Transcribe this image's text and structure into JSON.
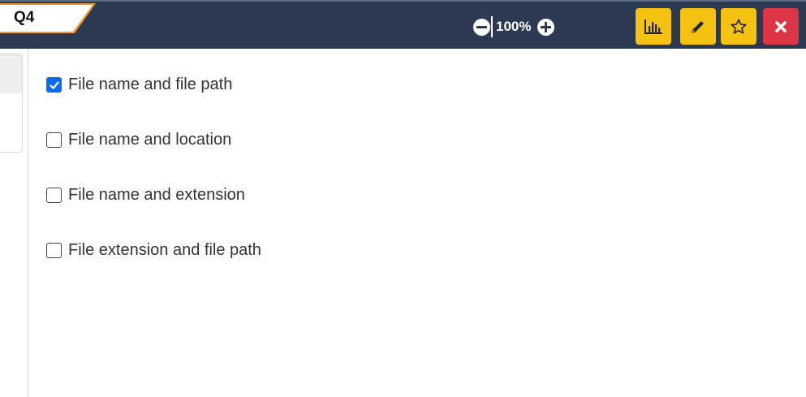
{
  "header": {
    "question_tab": "Q4",
    "zoom_level": "100%",
    "tools": [
      {
        "name": "stats",
        "icon": "bar-chart-icon"
      },
      {
        "name": "edit",
        "icon": "pencil-icon"
      },
      {
        "name": "favorite",
        "icon": "star-icon"
      },
      {
        "name": "close",
        "icon": "close-icon"
      }
    ],
    "colors": {
      "bar": "#2b3a52",
      "tab_accent": "#f0962a",
      "tool": "#f5c211",
      "close": "#dc3545",
      "check": "#0b6bf0"
    }
  },
  "options": [
    {
      "label": "File name and file path",
      "checked": true
    },
    {
      "label": "File name and location",
      "checked": false
    },
    {
      "label": "File name and extension",
      "checked": false
    },
    {
      "label": "File extension and file path",
      "checked": false
    }
  ]
}
